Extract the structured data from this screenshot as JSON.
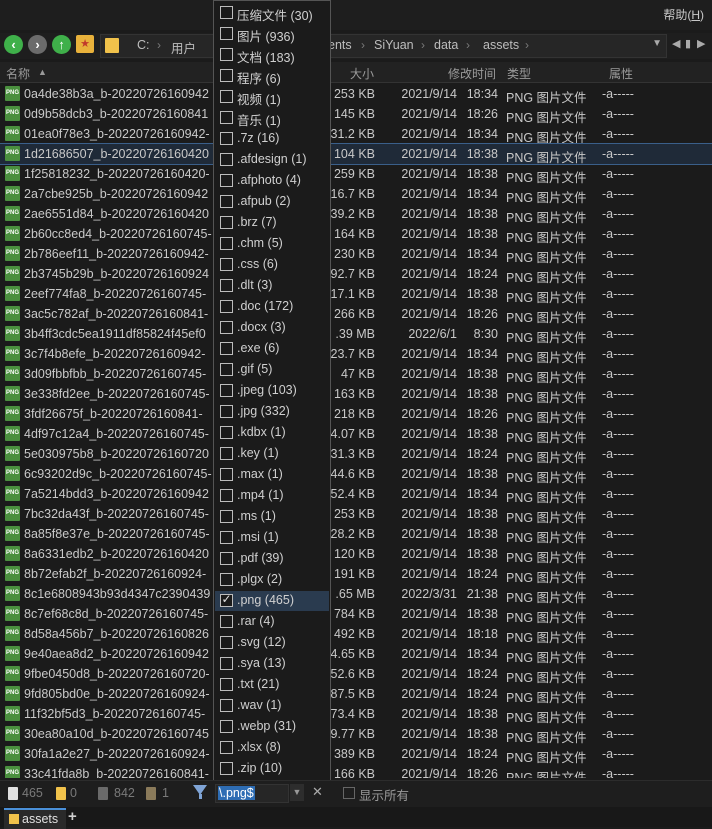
{
  "window": {
    "help_label": "帮助(",
    "help_key": "H",
    "help_close": ")"
  },
  "breadcrumb": [
    "C:",
    "用户",
    "ents",
    "SiYuan",
    "data",
    "assets"
  ],
  "columns": {
    "name": "名称",
    "size": "大小",
    "modified": "修改时间",
    "type": "类型",
    "attr": "属性"
  },
  "files": [
    {
      "name": "0a4de38b3a_b-20220726160942",
      "size": "253 KB",
      "date": "2021/9/14",
      "time": "18:34",
      "type": "PNG 图片文件",
      "attr": "-a-----"
    },
    {
      "name": "0d9b58dcb3_b-20220726160841",
      "size": "145 KB",
      "date": "2021/9/14",
      "time": "18:26",
      "type": "PNG 图片文件",
      "attr": "-a-----"
    },
    {
      "name": "01ea0f78e3_b-20220726160942-",
      "size": "31.2 KB",
      "date": "2021/9/14",
      "time": "18:34",
      "type": "PNG 图片文件",
      "attr": "-a-----"
    },
    {
      "name": "1d21686507_b-20220726160420",
      "size": "104 KB",
      "date": "2021/9/14",
      "time": "18:38",
      "type": "PNG 图片文件",
      "attr": "-a-----"
    },
    {
      "name": "1f25818232_b-20220726160420-",
      "size": "259 KB",
      "date": "2021/9/14",
      "time": "18:38",
      "type": "PNG 图片文件",
      "attr": "-a-----"
    },
    {
      "name": "2a7cbe925b_b-20220726160942",
      "size": "16.7 KB",
      "date": "2021/9/14",
      "time": "18:34",
      "type": "PNG 图片文件",
      "attr": "-a-----"
    },
    {
      "name": "2ae6551d84_b-20220726160420",
      "size": "39.2 KB",
      "date": "2021/9/14",
      "time": "18:38",
      "type": "PNG 图片文件",
      "attr": "-a-----"
    },
    {
      "name": "2b60cc8ed4_b-20220726160745-",
      "size": "164 KB",
      "date": "2021/9/14",
      "time": "18:38",
      "type": "PNG 图片文件",
      "attr": "-a-----"
    },
    {
      "name": "2b786eef11_b-20220726160942-",
      "size": "230 KB",
      "date": "2021/9/14",
      "time": "18:34",
      "type": "PNG 图片文件",
      "attr": "-a-----"
    },
    {
      "name": "2b3745b29b_b-20220726160924",
      "size": "92.7 KB",
      "date": "2021/9/14",
      "time": "18:24",
      "type": "PNG 图片文件",
      "attr": "-a-----"
    },
    {
      "name": "2eef774fa8_b-20220726160745-",
      "size": "17.1 KB",
      "date": "2021/9/14",
      "time": "18:38",
      "type": "PNG 图片文件",
      "attr": "-a-----"
    },
    {
      "name": "3ac5c782af_b-20220726160841-",
      "size": "266 KB",
      "date": "2021/9/14",
      "time": "18:26",
      "type": "PNG 图片文件",
      "attr": "-a-----"
    },
    {
      "name": "3b4ff3cdc5ea1911df85824f45ef0",
      "size": ".39 MB",
      "date": "2022/6/1",
      "time": "8:30",
      "type": "PNG 图片文件",
      "attr": "-a-----"
    },
    {
      "name": "3c7f4b8efe_b-20220726160942-",
      "size": "23.7 KB",
      "date": "2021/9/14",
      "time": "18:34",
      "type": "PNG 图片文件",
      "attr": "-a-----"
    },
    {
      "name": "3d09fbbfbb_b-20220726160745-",
      "size": "47 KB",
      "date": "2021/9/14",
      "time": "18:38",
      "type": "PNG 图片文件",
      "attr": "-a-----"
    },
    {
      "name": "3e338fd2ee_b-20220726160745-",
      "size": "163 KB",
      "date": "2021/9/14",
      "time": "18:38",
      "type": "PNG 图片文件",
      "attr": "-a-----"
    },
    {
      "name": "3fdf26675f_b-20220726160841-",
      "size": "218 KB",
      "date": "2021/9/14",
      "time": "18:26",
      "type": "PNG 图片文件",
      "attr": "-a-----"
    },
    {
      "name": "4df97c12a4_b-20220726160745-",
      "size": "4.07 KB",
      "date": "2021/9/14",
      "time": "18:38",
      "type": "PNG 图片文件",
      "attr": "-a-----"
    },
    {
      "name": "5e030975b8_b-20220726160720",
      "size": "31.3 KB",
      "date": "2021/9/14",
      "time": "18:24",
      "type": "PNG 图片文件",
      "attr": "-a-----"
    },
    {
      "name": "6c93202d9c_b-20220726160745-",
      "size": "44.6 KB",
      "date": "2021/9/14",
      "time": "18:38",
      "type": "PNG 图片文件",
      "attr": "-a-----"
    },
    {
      "name": "7a5214bdd3_b-20220726160942",
      "size": "52.4 KB",
      "date": "2021/9/14",
      "time": "18:34",
      "type": "PNG 图片文件",
      "attr": "-a-----"
    },
    {
      "name": "7bc32da43f_b-20220726160745-",
      "size": "253 KB",
      "date": "2021/9/14",
      "time": "18:38",
      "type": "PNG 图片文件",
      "attr": "-a-----"
    },
    {
      "name": "8a85f8e37e_b-20220726160745-",
      "size": "28.2 KB",
      "date": "2021/9/14",
      "time": "18:38",
      "type": "PNG 图片文件",
      "attr": "-a-----"
    },
    {
      "name": "8a6331edb2_b-20220726160420",
      "size": "120 KB",
      "date": "2021/9/14",
      "time": "18:38",
      "type": "PNG 图片文件",
      "attr": "-a-----"
    },
    {
      "name": "8b72efab2f_b-20220726160924-",
      "size": "191 KB",
      "date": "2021/9/14",
      "time": "18:24",
      "type": "PNG 图片文件",
      "attr": "-a-----"
    },
    {
      "name": "8c1e6808943b93d4347c2390439",
      "size": ".65 MB",
      "date": "2022/3/31",
      "time": "21:38",
      "type": "PNG 图片文件",
      "attr": "-a-----"
    },
    {
      "name": "8c7ef68c8d_b-20220726160745-",
      "size": "784 KB",
      "date": "2021/9/14",
      "time": "18:38",
      "type": "PNG 图片文件",
      "attr": "-a-----"
    },
    {
      "name": "8d58a456b7_b-20220726160826",
      "size": "492 KB",
      "date": "2021/9/14",
      "time": "18:18",
      "type": "PNG 图片文件",
      "attr": "-a-----"
    },
    {
      "name": "9e40aea8d2_b-20220726160942",
      "size": "4.65 KB",
      "date": "2021/9/14",
      "time": "18:34",
      "type": "PNG 图片文件",
      "attr": "-a-----"
    },
    {
      "name": "9fbe0450d8_b-20220726160720-",
      "size": "52.6 KB",
      "date": "2021/9/14",
      "time": "18:24",
      "type": "PNG 图片文件",
      "attr": "-a-----"
    },
    {
      "name": "9fd805bd0e_b-20220726160924-",
      "size": "87.5 KB",
      "date": "2021/9/14",
      "time": "18:24",
      "type": "PNG 图片文件",
      "attr": "-a-----"
    },
    {
      "name": "11f32bf5d3_b-20220726160745-",
      "size": "73.4 KB",
      "date": "2021/9/14",
      "time": "18:38",
      "type": "PNG 图片文件",
      "attr": "-a-----"
    },
    {
      "name": "30ea80a10d_b-20220726160745",
      "size": "9.77 KB",
      "date": "2021/9/14",
      "time": "18:38",
      "type": "PNG 图片文件",
      "attr": "-a-----"
    },
    {
      "name": "30fa1a2e27_b-20220726160924-",
      "size": "389 KB",
      "date": "2021/9/14",
      "time": "18:24",
      "type": "PNG 图片文件",
      "attr": "-a-----"
    },
    {
      "name": "33c41fda8b_b-20220726160841-",
      "size": "166 KB",
      "date": "2021/9/14",
      "time": "18:26",
      "type": "PNG 图片文件",
      "attr": "-a-----"
    }
  ],
  "file_icon_text": "PNG",
  "selected_row_index": 3,
  "filter_menu": [
    {
      "label": "压缩文件 (30)",
      "checked": false
    },
    {
      "label": "图片 (936)",
      "checked": false
    },
    {
      "label": "文档 (183)",
      "checked": false
    },
    {
      "label": "程序 (6)",
      "checked": false
    },
    {
      "label": "视频 (1)",
      "checked": false
    },
    {
      "label": "音乐 (1)",
      "checked": false
    },
    {
      "label": ".7z (16)",
      "checked": false
    },
    {
      "label": ".afdesign (1)",
      "checked": false
    },
    {
      "label": ".afphoto (4)",
      "checked": false
    },
    {
      "label": ".afpub (2)",
      "checked": false
    },
    {
      "label": ".brz (7)",
      "checked": false
    },
    {
      "label": ".chm (5)",
      "checked": false
    },
    {
      "label": ".css (6)",
      "checked": false
    },
    {
      "label": ".dlt (3)",
      "checked": false
    },
    {
      "label": ".doc (172)",
      "checked": false
    },
    {
      "label": ".docx (3)",
      "checked": false
    },
    {
      "label": ".exe (6)",
      "checked": false
    },
    {
      "label": ".gif (5)",
      "checked": false
    },
    {
      "label": ".jpeg (103)",
      "checked": false
    },
    {
      "label": ".jpg (332)",
      "checked": false
    },
    {
      "label": ".kdbx (1)",
      "checked": false
    },
    {
      "label": ".key (1)",
      "checked": false
    },
    {
      "label": ".max (1)",
      "checked": false
    },
    {
      "label": ".mp4 (1)",
      "checked": false
    },
    {
      "label": ".ms (1)",
      "checked": false
    },
    {
      "label": ".msi (1)",
      "checked": false
    },
    {
      "label": ".pdf (39)",
      "checked": false
    },
    {
      "label": ".plgx (2)",
      "checked": false
    },
    {
      "label": ".png (465)",
      "checked": true
    },
    {
      "label": ".rar (4)",
      "checked": false
    },
    {
      "label": ".svg (12)",
      "checked": false
    },
    {
      "label": ".sya (13)",
      "checked": false
    },
    {
      "label": ".txt (21)",
      "checked": false
    },
    {
      "label": ".wav (1)",
      "checked": false
    },
    {
      "label": ".webp (31)",
      "checked": false
    },
    {
      "label": ".xlsx (8)",
      "checked": false
    },
    {
      "label": ".zip (10)",
      "checked": false
    }
  ],
  "status": {
    "file_count": "465",
    "folder_count": "0",
    "hidden_count": "842",
    "other_count": "1",
    "filter_value": "\\.png$",
    "show_all_label": "显示所有"
  },
  "tabs": [
    {
      "label": "assets"
    }
  ],
  "colors": {
    "accent": "#2e6db4",
    "png_icon": "#4a8f3e",
    "folder": "#f1c24b",
    "nav_green": "#3fb04a"
  }
}
